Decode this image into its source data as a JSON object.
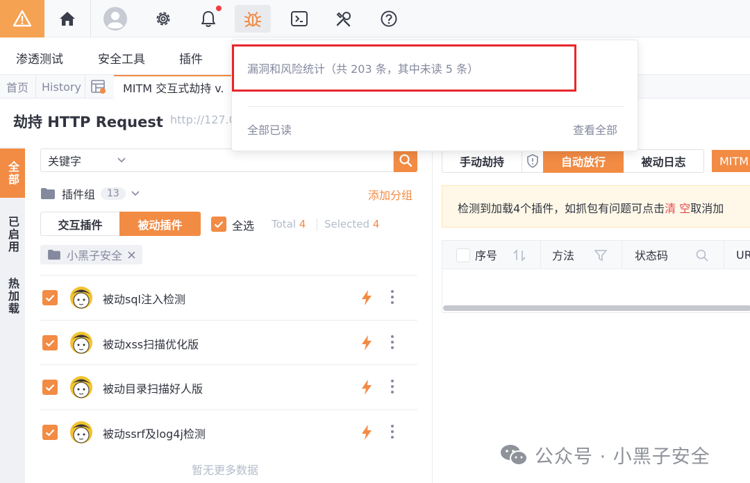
{
  "topbar": {
    "icons": [
      "warning-icon",
      "home-icon",
      "user-avatar-icon",
      "gear-icon",
      "bell-icon",
      "bug-icon",
      "terminal-icon",
      "tools-icon",
      "help-icon"
    ],
    "accent": "#f28b44",
    "logo_color": "#f6a253",
    "notification_dot_color": "#f13d3d"
  },
  "menu": {
    "items": [
      "渗透测试",
      "安全工具",
      "插件"
    ]
  },
  "tabs": {
    "home": "首页",
    "history": "History",
    "active": "MITM 交互式劫持 v."
  },
  "page": {
    "title": "劫持 HTTP Request",
    "url": "http://127.0"
  },
  "side_tabs": [
    "全部",
    "已启用",
    "热加载"
  ],
  "search": {
    "type_label": "关键字",
    "value": ""
  },
  "plugin_group": {
    "label": "插件组",
    "count": "13",
    "add_label": "添加分组"
  },
  "plugin_type": {
    "interactive": "交互插件",
    "passive": "被动插件"
  },
  "selection": {
    "select_all": "全选",
    "total_label": "Total",
    "total": "4",
    "selected_label": "Selected",
    "selected": "4"
  },
  "filter_chip": {
    "label": "小黑子安全"
  },
  "plugins": [
    {
      "name": "被动sql注入检测"
    },
    {
      "name": "被动xss扫描优化版"
    },
    {
      "name": "被动目录扫描好人版"
    },
    {
      "name": "被动ssrf及log4j检测"
    }
  ],
  "list_footer": "暂无更多数据",
  "modes": {
    "manual": "手动劫持",
    "auto": "自动放行",
    "passive_log": "被动日志",
    "mitm_tag": "MITM"
  },
  "notice": {
    "before": "检测到加载4个插件，如抓包有问题可点击",
    "link": "清 空",
    "after": "取消加"
  },
  "table": {
    "columns": [
      "序号",
      "方法",
      "状态码",
      "UR"
    ]
  },
  "popover": {
    "stat": "漏洞和风险统计（共 203 条，其中未读 5 条）",
    "mark_all_read": "全部已读",
    "view_all": "查看全部"
  },
  "watermark": "公众号 · 小黑子安全"
}
